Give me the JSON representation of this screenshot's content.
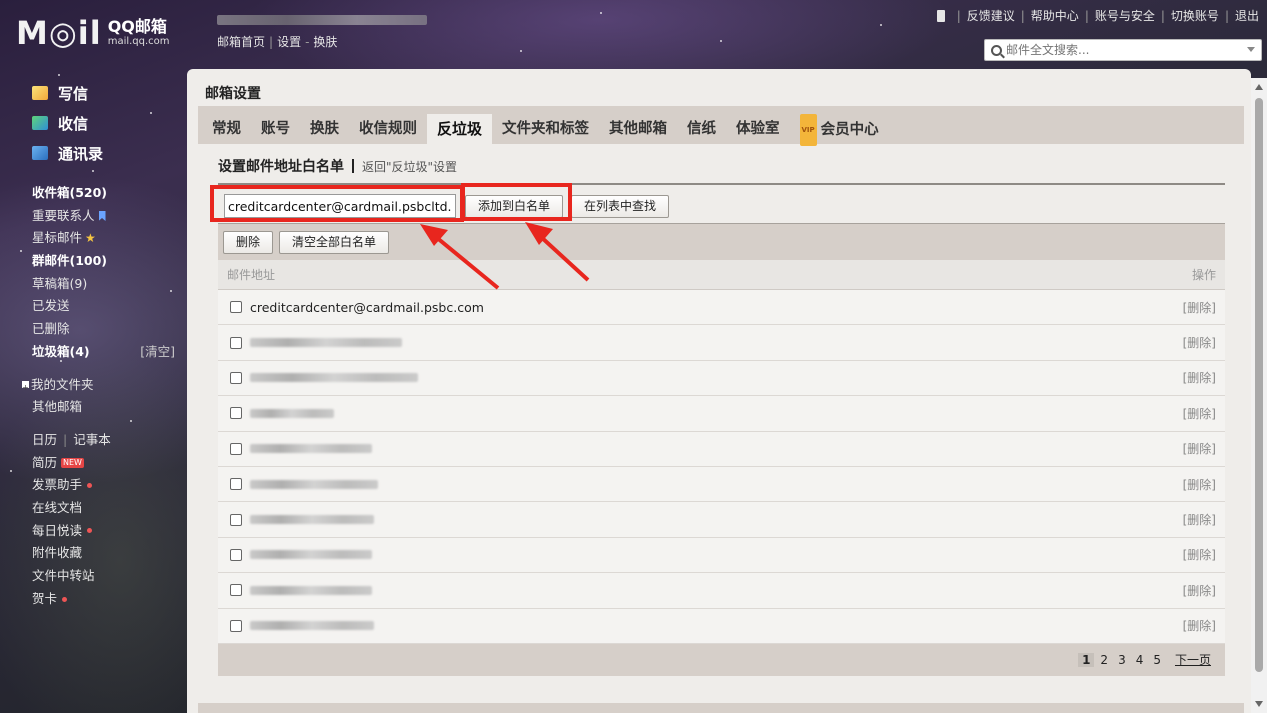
{
  "header": {
    "logo_mail": "M◎il",
    "brand_name": "QQ邮箱",
    "brand_domain": "mail.qq.com",
    "links": [
      "邮箱首页",
      "设置",
      "换肤"
    ],
    "top_links": [
      "反馈建议",
      "帮助中心",
      "账号与安全",
      "切换账号",
      "退出"
    ],
    "search_placeholder": "邮件全文搜索..."
  },
  "sidebar": {
    "main": [
      {
        "label": "写信",
        "icon": "write-icon"
      },
      {
        "label": "收信",
        "icon": "inbox-download-icon"
      },
      {
        "label": "通讯录",
        "icon": "contacts-icon"
      }
    ],
    "folders": [
      {
        "label": "收件箱(520)",
        "bold": true
      },
      {
        "label": "重要联系人",
        "icon": "bookmark-icon"
      },
      {
        "label": "星标邮件",
        "icon": "star-icon"
      },
      {
        "label": "群邮件(100)",
        "bold": true
      },
      {
        "label": "草稿箱(9)"
      },
      {
        "label": "已发送"
      },
      {
        "label": "已删除"
      },
      {
        "label": "垃圾箱(4)",
        "bold": true,
        "action": "[清空]"
      }
    ],
    "my_folders": "我的文件夹",
    "other_mailbox": "其他邮箱",
    "tools": [
      {
        "label": "日历",
        "extra": "记事本"
      },
      {
        "label": "简历",
        "badge": "NEW"
      },
      {
        "label": "发票助手",
        "dot": true
      },
      {
        "label": "在线文档"
      },
      {
        "label": "每日悦读",
        "dot": true
      },
      {
        "label": "附件收藏"
      },
      {
        "label": "文件中转站"
      },
      {
        "label": "贺卡",
        "dot": true
      }
    ]
  },
  "panel": {
    "title": "邮箱设置",
    "tabs": [
      "常规",
      "账号",
      "换肤",
      "收信规则",
      "反垃圾",
      "文件夹和标签",
      "其他邮箱",
      "信纸",
      "体验室",
      "会员中心"
    ],
    "active_tab": "反垃圾",
    "vip_badge": "VIP",
    "section_title": "设置邮件地址白名单",
    "back_link": "返回\"反垃圾\"设置",
    "input_value": "creditcardcenter@cardmail.psbcltd.cn",
    "add_button": "添加到白名单",
    "find_button": "在列表中查找",
    "delete_button": "删除",
    "clear_button": "清空全部白名单",
    "col_address": "邮件地址",
    "col_action": "操作",
    "rows": [
      {
        "address": "creditcardcenter@cardmail.psbc.com",
        "action": "[删除]"
      },
      {
        "address": "",
        "action": "[删除]"
      },
      {
        "address": "",
        "action": "[删除]"
      },
      {
        "address": "",
        "action": "[删除]"
      },
      {
        "address": "",
        "action": "[删除]"
      },
      {
        "address": "",
        "action": "[删除]"
      },
      {
        "address": "",
        "action": "[删除]"
      },
      {
        "address": "",
        "action": "[删除]"
      },
      {
        "address": "",
        "action": "[删除]"
      },
      {
        "address": "",
        "action": "[删除]"
      }
    ],
    "pages": [
      "1",
      "2",
      "3",
      "4",
      "5"
    ],
    "current_page": "1",
    "next_page": "下一页"
  },
  "colors": {
    "annotation": "#e8261e",
    "panel_bg": "#efedea",
    "tab_bar": "#d6cfc9"
  }
}
